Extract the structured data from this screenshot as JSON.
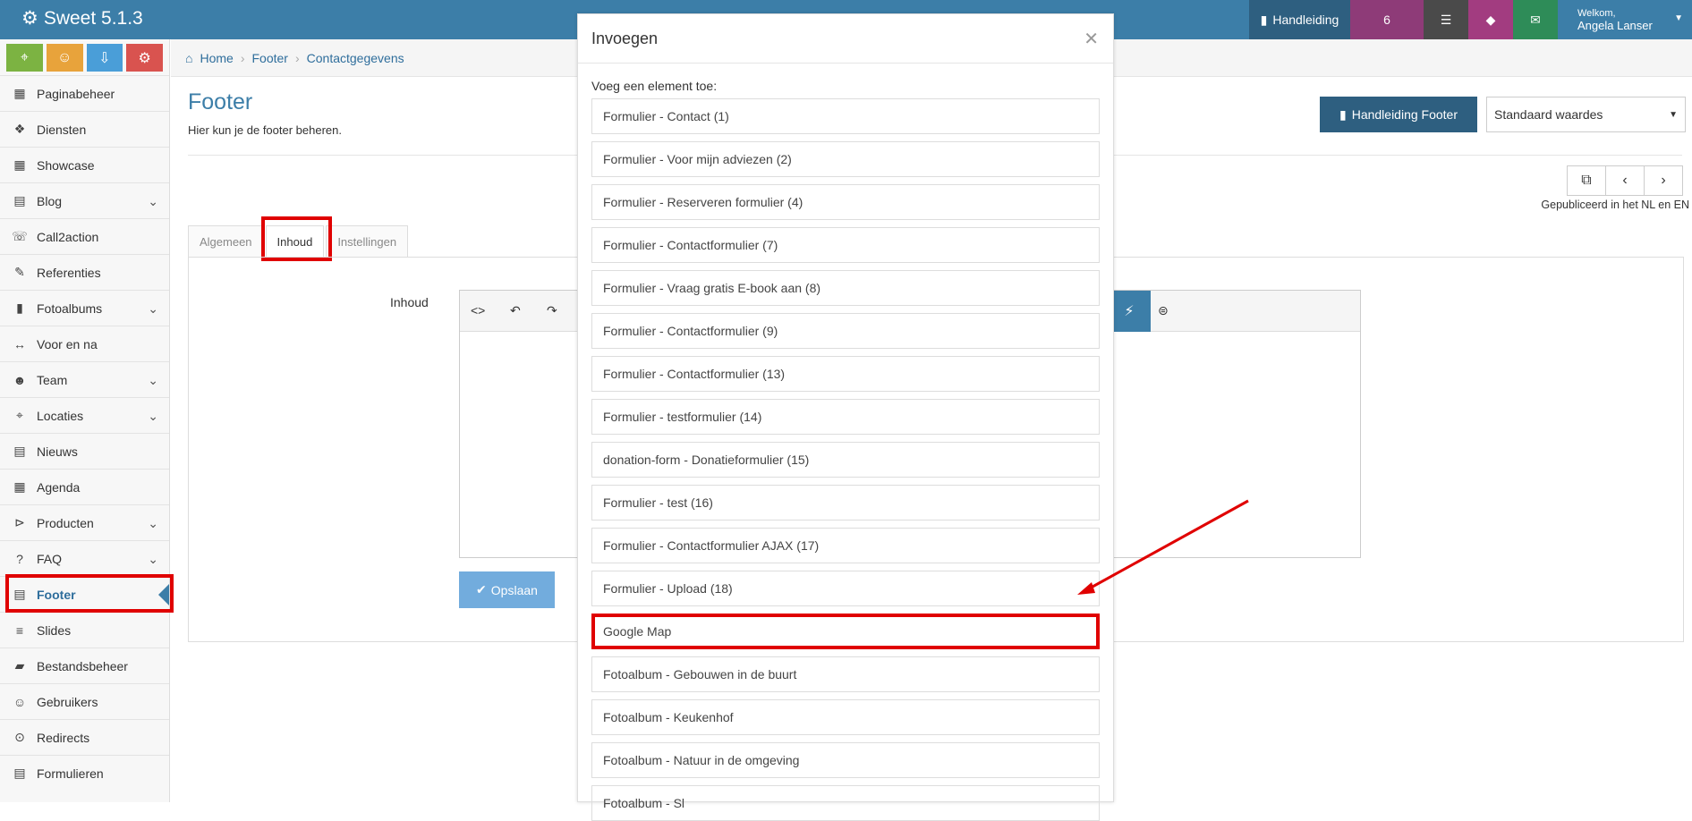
{
  "app": {
    "title": "Sweet 5.1.3"
  },
  "topbar": {
    "manual_label": "Handleiding",
    "count": "6",
    "welcome": "Welkom,",
    "user_name": "Angela Lanser"
  },
  "sidebar": {
    "items": [
      {
        "label": "Paginabeheer",
        "icon": "table-icon"
      },
      {
        "label": "Diensten",
        "icon": "cubes-icon"
      },
      {
        "label": "Showcase",
        "icon": "grid-icon"
      },
      {
        "label": "Blog",
        "icon": "file-icon"
      },
      {
        "label": "Call2action",
        "icon": "phone-icon"
      },
      {
        "label": "Referenties",
        "icon": "comments-icon"
      },
      {
        "label": "Fotoalbums",
        "icon": "book-icon"
      },
      {
        "label": "Voor en na",
        "icon": "arrows-h-icon"
      },
      {
        "label": "Team",
        "icon": "users-icon"
      },
      {
        "label": "Locaties",
        "icon": "map-marker-icon"
      },
      {
        "label": "Nieuws",
        "icon": "newspaper-icon"
      },
      {
        "label": "Agenda",
        "icon": "calendar-icon"
      },
      {
        "label": "Producten",
        "icon": "tag-icon"
      },
      {
        "label": "FAQ",
        "icon": "question-icon"
      },
      {
        "label": "Footer",
        "icon": "list-alt-icon"
      },
      {
        "label": "Slides",
        "icon": "sliders-icon"
      },
      {
        "label": "Bestandsbeheer",
        "icon": "folder-icon"
      },
      {
        "label": "Gebruikers",
        "icon": "user-icon"
      },
      {
        "label": "Redirects",
        "icon": "arrow-circle-icon"
      },
      {
        "label": "Formulieren",
        "icon": "form-icon"
      }
    ]
  },
  "breadcrumb": {
    "home": "Home",
    "section": "Footer",
    "current": "Contactgegevens"
  },
  "page": {
    "title": "Footer",
    "subtitle": "Hier kun je de footer beheren.",
    "manual_button": "Handleiding Footer",
    "defaults_select": "Standaard waardes",
    "published": "Gepubliceerd in het NL en EN"
  },
  "tabs": [
    "Algemeen",
    "Inhoud",
    "Instellingen"
  ],
  "form": {
    "content_label": "Inhoud",
    "save_button": "Opslaan"
  },
  "modal": {
    "title": "Invoegen",
    "intro": "Voeg een element toe:",
    "options": [
      "Formulier - Contact (1)",
      "Formulier - Voor mijn adviezen (2)",
      "Formulier - Reserveren formulier (4)",
      "Formulier - Contactformulier (7)",
      "Formulier - Vraag gratis E-book aan (8)",
      "Formulier - Contactformulier (9)",
      "Formulier - Contactformulier (13)",
      "Formulier - testformulier (14)",
      "donation-form - Donatieformulier (15)",
      "Formulier - test (16)",
      "Formulier - Contactformulier AJAX (17)",
      "Formulier - Upload (18)",
      "Google Map",
      "Fotoalbum - Gebouwen in de buurt",
      "Fotoalbum - Keukenhof",
      "Fotoalbum - Natuur in de omgeving",
      "Fotoalbum - Sl"
    ]
  },
  "colors": {
    "primary": "#3c7ea8",
    "dark_primary": "#2e5f80",
    "highlight": "#e00000"
  }
}
